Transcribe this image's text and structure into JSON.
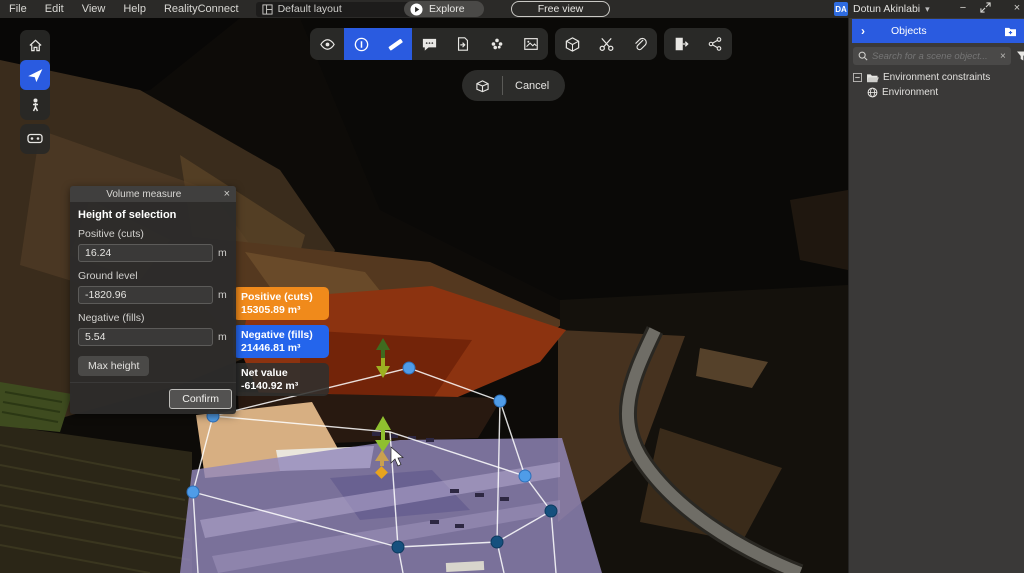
{
  "menu_bar": {
    "items": [
      "File",
      "Edit",
      "View",
      "Help",
      "RealityConnect"
    ],
    "layout_select_value": "Default layout",
    "explore_label": "Explore",
    "free_view_label": "Free view",
    "user": {
      "initials": "DA",
      "name": "Dotun Akinlabi"
    }
  },
  "glyphs": {
    "chevron_down": "▾",
    "close": "×",
    "minus": "−",
    "collapse_right": "›"
  },
  "cancel_bar": {
    "cancel_label": "Cancel"
  },
  "volume_panel": {
    "title": "Volume measure",
    "section": "Height of selection",
    "fields": [
      {
        "label": "Positive (cuts)",
        "value": "16.24",
        "unit": "m"
      },
      {
        "label": "Ground level",
        "value": "-1820.96",
        "unit": "m"
      },
      {
        "label": "Negative (fills)",
        "value": "5.54",
        "unit": "m"
      }
    ],
    "max_height_label": "Max height",
    "confirm_label": "Confirm"
  },
  "measure_labels": {
    "positive": {
      "title": "Positive (cuts)",
      "value": "15305.89 m³",
      "color": "#f08a1b"
    },
    "negative": {
      "title": "Negative (fills)",
      "value": "21446.81 m³",
      "color": "#2465ec"
    },
    "net": {
      "title": "Net value",
      "value": "-6140.92 m³"
    }
  },
  "objects_panel": {
    "title": "Objects",
    "search_placeholder": "Search for a scene object...",
    "tree": [
      {
        "label": "Environment constraints"
      },
      {
        "label": "Environment"
      }
    ]
  },
  "colors": {
    "accent": "#2a5be0",
    "positive_orange": "#f08a1b",
    "negative_blue": "#2465ec"
  }
}
